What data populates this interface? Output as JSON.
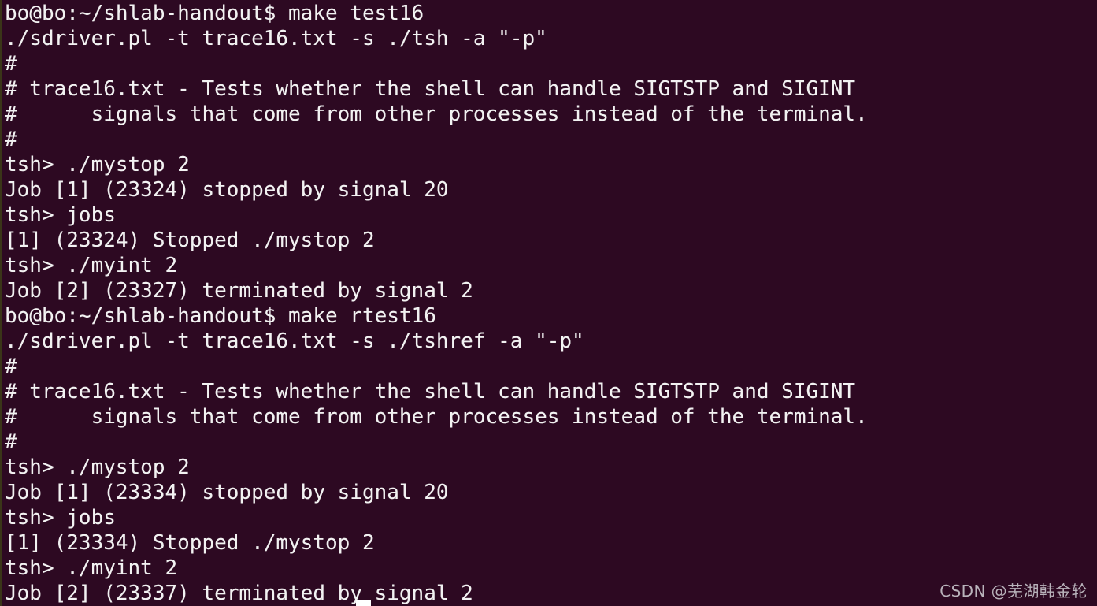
{
  "terminal": {
    "type": "gnome-terminal",
    "background_color": "#2d0922",
    "foreground_color": "#f2f2f2",
    "columns": 71,
    "rows": 24,
    "prompt": "bo@bo:~/shlab-handout$",
    "shell_prompt": "tsh>",
    "user": "bo",
    "host": "bo",
    "cwd": "~/shlab-handout",
    "lines": [
      "bo@bo:~/shlab-handout$ make test16",
      "./sdriver.pl -t trace16.txt -s ./tsh -a \"-p\"",
      "#",
      "# trace16.txt - Tests whether the shell can handle SIGTSTP and SIGINT",
      "#      signals that come from other processes instead of the terminal.",
      "#",
      "tsh> ./mystop 2",
      "Job [1] (23324) stopped by signal 20",
      "tsh> jobs",
      "[1] (23324) Stopped ./mystop 2",
      "tsh> ./myint 2",
      "Job [2] (23327) terminated by signal 2",
      "bo@bo:~/shlab-handout$ make rtest16",
      "./sdriver.pl -t trace16.txt -s ./tshref -a \"-p\"",
      "#",
      "# trace16.txt - Tests whether the shell can handle SIGTSTP and SIGINT",
      "#      signals that come from other processes instead of the terminal.",
      "#",
      "tsh> ./mystop 2",
      "Job [1] (23334) stopped by signal 20",
      "tsh> jobs",
      "[1] (23334) Stopped ./mystop 2",
      "tsh> ./myint 2",
      "Job [2] (23337) terminated by signal 2"
    ],
    "commands_run": [
      "make test16",
      "make rtest16"
    ],
    "test_file": "trace16.txt",
    "driver": "./sdriver.pl",
    "shells_tested": [
      "./tsh",
      "./tshref"
    ],
    "driver_args": "-a \"-p\"",
    "jobs": [
      {
        "job_id": "[1]",
        "pid": "23324",
        "state": "Stopped",
        "command": "./mystop 2",
        "signal": "20"
      },
      {
        "job_id": "[2]",
        "pid": "23327",
        "state": "terminated",
        "command": "./myint 2",
        "signal": "2"
      },
      {
        "job_id": "[1]",
        "pid": "23334",
        "state": "Stopped",
        "command": "./mystop 2",
        "signal": "20"
      },
      {
        "job_id": "[2]",
        "pid": "23337",
        "state": "terminated",
        "command": "./myint 2",
        "signal": "2"
      }
    ]
  },
  "cursor": {
    "visible": true,
    "shape": "block",
    "color": "#ffffff"
  },
  "watermark": {
    "text": "CSDN @芜湖韩金轮",
    "color": "#b9b3bb"
  }
}
